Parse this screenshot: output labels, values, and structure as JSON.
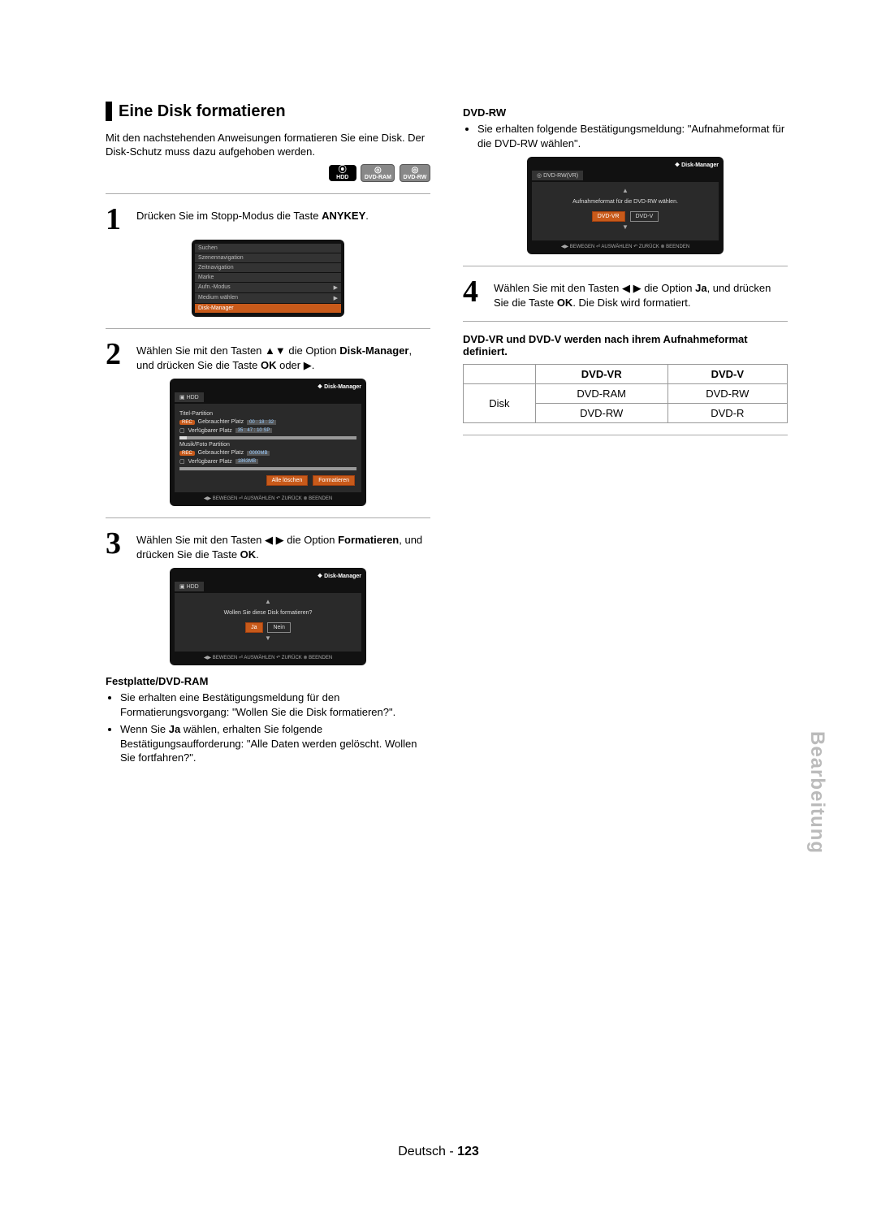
{
  "heading": "Eine Disk formatieren",
  "intro": "Mit den nachstehenden Anweisungen formatieren Sie eine Disk. Der Disk-Schutz muss dazu aufgehoben werden.",
  "badges": {
    "hdd": "HDD",
    "ram": "DVD-RAM",
    "rw": "DVD-RW"
  },
  "step1": {
    "num": "1",
    "pre": "Drücken Sie im Stopp-Modus die Taste ",
    "bold": "ANYKEY",
    "post": "."
  },
  "osd1_items": [
    "Suchen",
    "Szenennavigation",
    "Zeitnavigation",
    "Marke",
    "Aufn.-Modus",
    "Medium wählen",
    "Disk-Manager"
  ],
  "osd1_selected_index": 6,
  "step2": {
    "num": "2",
    "text_parts": [
      "Wählen Sie mit den Tasten ▲▼ die Option ",
      "Disk-Manager",
      ", und drücken Sie die Taste ",
      "OK",
      " oder ▶."
    ]
  },
  "osd2": {
    "title": "Disk-Manager",
    "tab": "HDD",
    "titel_partition": "Titel-Partition",
    "gebrauchter": "Gebrauchter Platz",
    "g1_val": "00 : 18 : 32",
    "verfugbar": "Verfügbarer Platz",
    "v1_val": "35 : 47 : 10 SP",
    "music_partition": "Musik/Foto Partition",
    "g2_val": "0000MB",
    "v2_val": "1863MB",
    "btn_delete": "Alle löschen",
    "btn_format": "Formatieren",
    "footer": "◀▶ BEWEGEN   ⏎ AUSWÄHLEN   ↶ ZURÜCK   ⊗ BEENDEN"
  },
  "step3": {
    "num": "3",
    "text_parts": [
      "Wählen Sie mit den Tasten ◀ ▶ die Option ",
      "Formatieren",
      ", und drücken Sie die Taste ",
      "OK",
      "."
    ]
  },
  "osd3": {
    "title": "Disk-Manager",
    "tab": "HDD",
    "question": "Wollen Sie diese Disk formatieren?",
    "yes": "Ja",
    "no": "Nein",
    "footer": "◀▶ BEWEGEN   ⏎ AUSWÄHLEN   ↶ ZURÜCK   ⊗ BEENDEN"
  },
  "hdd_ram_heading": "Festplatte/DVD-RAM",
  "hdd_ram_bullet1": "Sie erhalten eine Bestätigungsmeldung für den Formatierungsvorgang: \"Wollen Sie die Disk formatieren?\".",
  "hdd_ram_bullet2_parts": [
    "Wenn Sie ",
    "Ja",
    " wählen, erhalten Sie folgende Bestätigungsaufforderung: \"Alle Daten werden gelöscht. Wollen Sie fortfahren?\"."
  ],
  "dvd_rw_heading": "DVD-RW",
  "dvd_rw_bullet": "Sie erhalten folgende Bestätigungsmeldung: \"Aufnahmeformat für die DVD-RW wählen\".",
  "osd4": {
    "title": "Disk-Manager",
    "tab": "DVD-RW(VR)",
    "question": "Aufnahmeformat für die DVD-RW wählen.",
    "opt1": "DVD-VR",
    "opt2": "DVD-V",
    "footer": "◀▶ BEWEGEN   ⏎ AUSWÄHLEN   ↶ ZURÜCK   ⊗ BEENDEN"
  },
  "step4": {
    "num": "4",
    "text_parts": [
      "Wählen Sie mit den Tasten ◀ ▶ die Option ",
      "Ja",
      ", und drücken Sie die Taste ",
      "OK",
      ". Die Disk wird formatiert."
    ]
  },
  "format_heading": "DVD-VR und DVD-V werden nach ihrem Aufnahmeformat definiert.",
  "format_table": {
    "h1": "DVD-VR",
    "h2": "DVD-V",
    "rowlabel": "Disk",
    "vr": [
      "DVD-RAM",
      "DVD-RW"
    ],
    "v": [
      "DVD-RW",
      "DVD-R"
    ]
  },
  "side_tab": "Bearbeitung",
  "footer_lang": "Deutsch",
  "footer_page": "123"
}
